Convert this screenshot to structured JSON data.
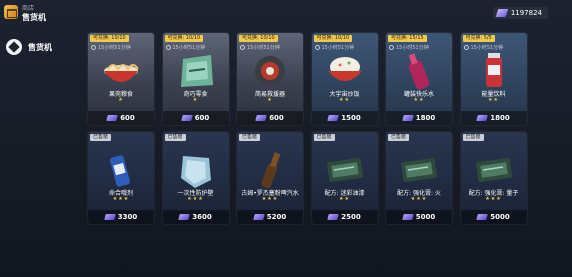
{
  "header": {
    "shop_label": "商店",
    "title": "售货机",
    "currency": {
      "icon": "gem-icon",
      "value": "1197824"
    }
  },
  "sidebar": {
    "items": [
      {
        "label": "售货机",
        "icon": "vending-machine-icon",
        "selected": true
      }
    ]
  },
  "items": [
    {
      "tag": "可兑换: 10/10",
      "timer": "15小时51分钟",
      "name": "果壳粮食",
      "stars": "★",
      "price": "600",
      "rarity": "common",
      "sold": false,
      "art": "bowl-noodles"
    },
    {
      "tag": "可兑换: 10/10",
      "timer": "15小时51分钟",
      "name": "奇巧零食",
      "stars": "★",
      "price": "600",
      "rarity": "common",
      "sold": false,
      "art": "snack-bag"
    },
    {
      "tag": "可兑换: 10/10",
      "timer": "15小时51分钟",
      "name": "简易救援器",
      "stars": "★",
      "price": "600",
      "rarity": "common",
      "sold": false,
      "art": "rescue-device"
    },
    {
      "tag": "可兑换: 10/10",
      "timer": "15小时51分钟",
      "name": "大宇宙炒饭",
      "stars": "★★",
      "price": "1500",
      "rarity": "green",
      "sold": false,
      "art": "fried-rice"
    },
    {
      "tag": "可兑换: 15/15",
      "timer": "15小时51分钟",
      "name": "罐装快乐水",
      "stars": "★★",
      "price": "1800",
      "rarity": "green",
      "sold": false,
      "art": "soda-bottle"
    },
    {
      "tag": "可兑换: 5/5",
      "timer": "15小时51分钟",
      "name": "能量饮料",
      "stars": "★★",
      "price": "1800",
      "rarity": "green",
      "sold": false,
      "art": "energy-drink"
    },
    {
      "tag": "已售罄",
      "timer": "",
      "name": "命合哦剂",
      "stars": "★★★",
      "price": "3300",
      "rarity": "blue",
      "sold": true,
      "art": "can"
    },
    {
      "tag": "已售罄",
      "timer": "",
      "name": "一次性防护壁",
      "stars": "★★★",
      "price": "3600",
      "rarity": "blue",
      "sold": true,
      "art": "shield"
    },
    {
      "tag": "已售罄",
      "timer": "",
      "name": "古姆•罗杰塞粉啤汽水",
      "stars": "★★★",
      "price": "5200",
      "rarity": "blue",
      "sold": true,
      "art": "beer-bottle"
    },
    {
      "tag": "已售罄",
      "timer": "",
      "name": "配方: 迷彩油漆",
      "stars": "★★",
      "price": "2500",
      "rarity": "blue",
      "sold": true,
      "art": "recipe"
    },
    {
      "tag": "已售罄",
      "timer": "",
      "name": "配方: 强化膏: 火",
      "stars": "★★★",
      "price": "5000",
      "rarity": "blue",
      "sold": true,
      "art": "recipe"
    },
    {
      "tag": "已售罄",
      "timer": "",
      "name": "配方: 强化膏: 量子",
      "stars": "★★★",
      "price": "5000",
      "rarity": "blue",
      "sold": true,
      "art": "recipe"
    }
  ]
}
